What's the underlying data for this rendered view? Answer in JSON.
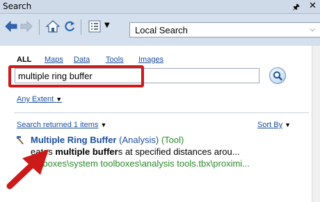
{
  "window": {
    "title": "Search"
  },
  "toolbar": {
    "scope_value": "Local Search"
  },
  "tabs": [
    {
      "label": "ALL",
      "active": true
    },
    {
      "label": "Maps",
      "active": false
    },
    {
      "label": "Data",
      "active": false
    },
    {
      "label": "Tools",
      "active": false
    },
    {
      "label": "Images",
      "active": false
    }
  ],
  "search": {
    "value": "multiple ring buffer",
    "extent_label": "Any Extent"
  },
  "results_header": {
    "summary": "Search returned 1 items",
    "sort_label": "Sort By"
  },
  "results": [
    {
      "name": "Multiple Ring Buffer",
      "category": "(Analysis)",
      "type": "(Tool)",
      "description_prefix": "eates ",
      "description_bold1": "multiple buffer",
      "description_mid": "s at specified distances arou...",
      "path": "oolboxes\\system toolboxes\\analysis tools.tbx\\proximi..."
    }
  ],
  "colors": {
    "link": "#1a4ea0",
    "type_green": "#2a8a2a",
    "highlight_red": "#cc1a1a",
    "toolbar_bg": "#d5e0ee"
  }
}
